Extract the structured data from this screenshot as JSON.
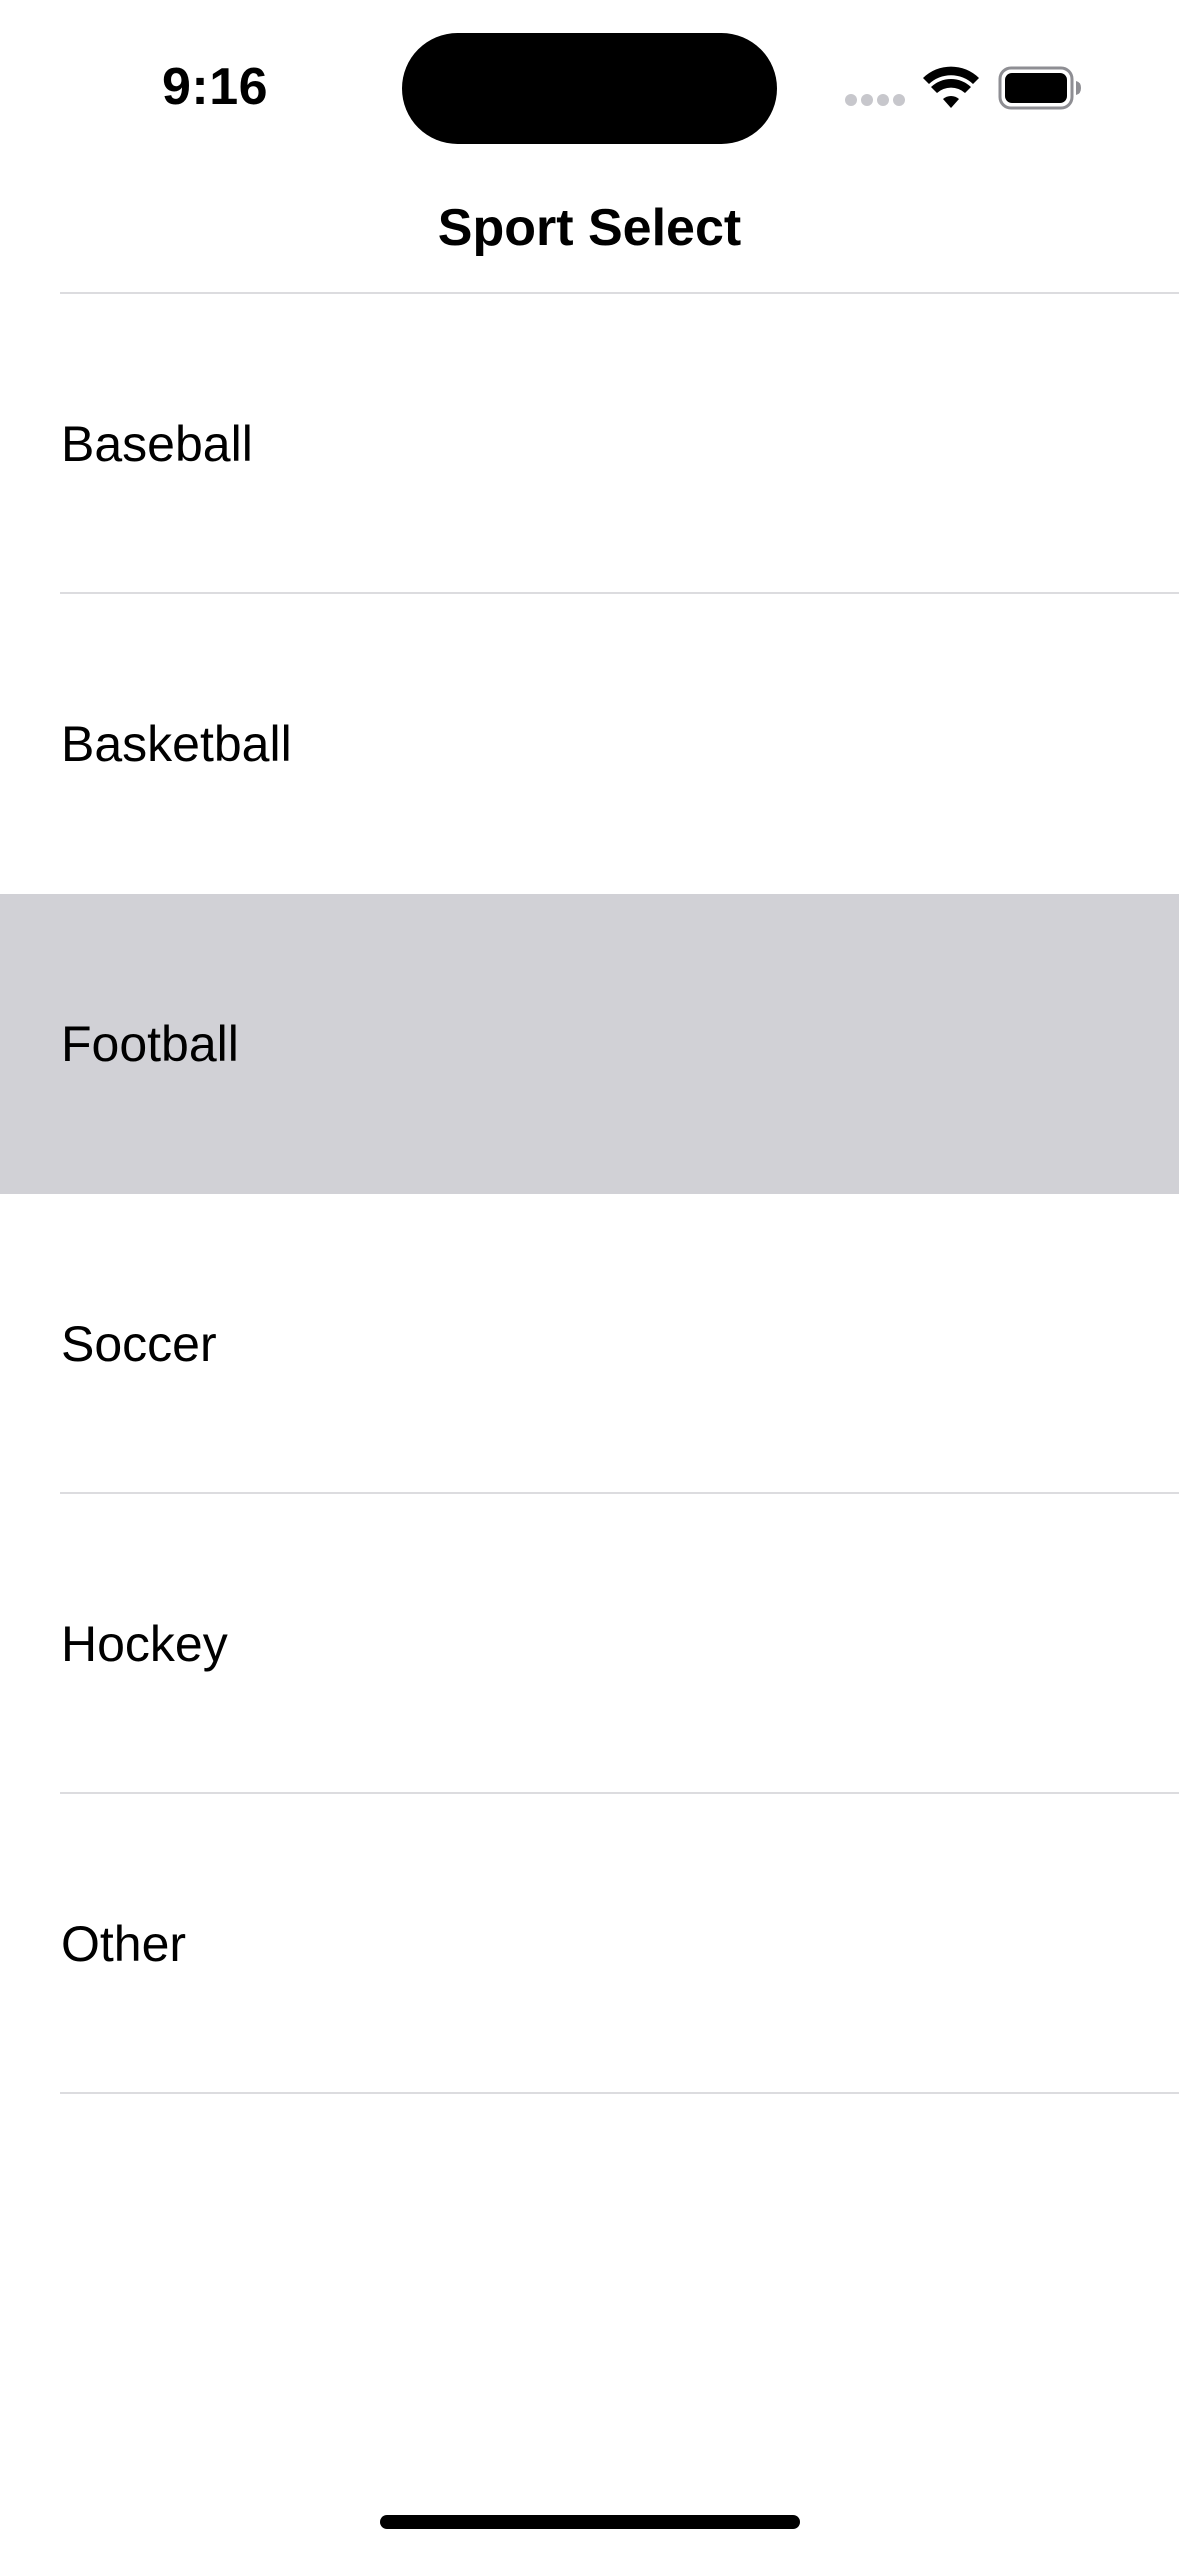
{
  "status_bar": {
    "time": "9:16",
    "icons": [
      "cellular-signal-icon",
      "wifi-icon",
      "battery-icon"
    ]
  },
  "nav": {
    "title": "Sport Select"
  },
  "list": {
    "items": [
      {
        "label": "Baseball",
        "selected": false
      },
      {
        "label": "Basketball",
        "selected": false
      },
      {
        "label": "Football",
        "selected": true
      },
      {
        "label": "Soccer",
        "selected": false
      },
      {
        "label": "Hockey",
        "selected": false
      },
      {
        "label": "Other",
        "selected": false
      }
    ]
  },
  "colors": {
    "background": "#ffffff",
    "selected_row": "#d1d1d6",
    "separator": "#dcdcdf",
    "text": "#000000"
  }
}
